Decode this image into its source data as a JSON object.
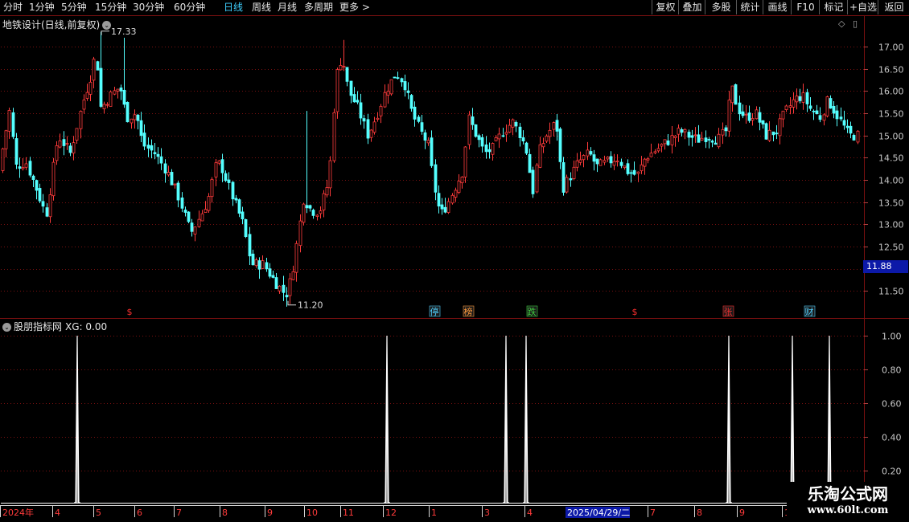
{
  "toolbar": {
    "timeframes": [
      "分时",
      "1分钟",
      "5分钟",
      "15分钟",
      "30分钟",
      "60分钟",
      "日线",
      "周线",
      "月线",
      "多周期",
      "更多 >"
    ],
    "active_timeframe": "日线",
    "right_buttons": [
      "复权",
      "叠加",
      "多股",
      "统计",
      "画线",
      "F10",
      "标记",
      "+自选",
      "返回"
    ]
  },
  "main_chart": {
    "title": "地铁设计(日线,前复权)",
    "high_label": "17.33",
    "low_label": "11.20",
    "current_price_tag": "11.88",
    "price_axis": [
      "17.00",
      "16.50",
      "16.00",
      "15.50",
      "15.00",
      "14.50",
      "14.00",
      "13.50",
      "13.00",
      "12.50",
      "12.00",
      "11.50"
    ],
    "event_markers": [
      {
        "text": "$",
        "color": "#ff3030"
      },
      {
        "text": "停",
        "color": "#4fd0ff"
      },
      {
        "text": "榜",
        "color": "#ff9a3c"
      },
      {
        "text": "跌",
        "color": "#3fd040"
      },
      {
        "text": "$",
        "color": "#ff3030"
      },
      {
        "text": "张",
        "color": "#ff3030"
      },
      {
        "text": "财",
        "color": "#4fd0ff"
      }
    ]
  },
  "indicator": {
    "name": "股朋指标网",
    "xg_label": "XG: 0.00",
    "axis": [
      "1.00",
      "0.80",
      "0.60",
      "0.40",
      "0.20"
    ]
  },
  "time_axis": {
    "labels": [
      "2024年",
      "4",
      "5",
      "6",
      "7",
      "8",
      "9",
      "10",
      "11",
      "12",
      "1",
      "3",
      "4",
      "2025/04/29/二",
      "7",
      "8",
      "9",
      "1"
    ]
  },
  "watermark": {
    "line1": "乐淘公式网",
    "line2": "www.60lt.com"
  },
  "colors": {
    "up": "#ff3b3b",
    "down": "#54ffff",
    "grid": "#7a1010",
    "axis": "#b0b0b0",
    "highlight": "#0c19a8"
  },
  "chart_data": {
    "type": "candlestick",
    "ylim": [
      11.2,
      17.33
    ],
    "signal_values": [
      1,
      1,
      1,
      1,
      1,
      1,
      1
    ],
    "signal_ylim": [
      0,
      1.0
    ]
  }
}
